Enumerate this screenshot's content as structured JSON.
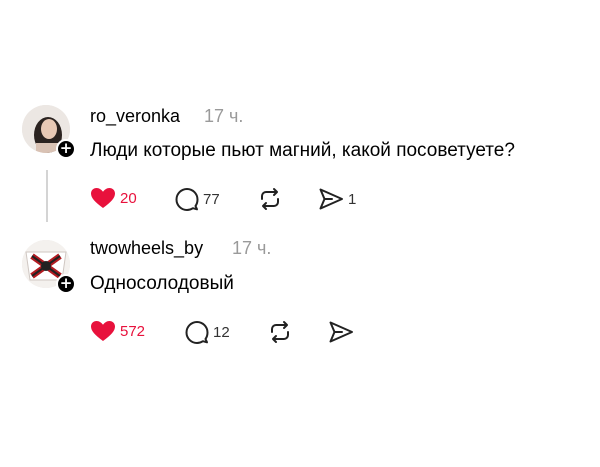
{
  "posts": [
    {
      "username": "ro_veronka",
      "time": "17 ч.",
      "text": "Люди которые пьют магний, какой посоветуете?",
      "likes": "20",
      "replies": "77",
      "shares": "1",
      "liked": true
    },
    {
      "username": "twowheels_by",
      "time": "17 ч.",
      "text": "Односолодовый",
      "likes": "572",
      "replies": "12",
      "shares": "",
      "liked": true
    }
  ],
  "colors": {
    "like": "#e8113c",
    "muted": "#9a9a9a",
    "thread_line": "#d4d4d4"
  },
  "icons": [
    "heart-icon",
    "comment-icon",
    "repost-icon",
    "send-icon",
    "plus-icon"
  ]
}
